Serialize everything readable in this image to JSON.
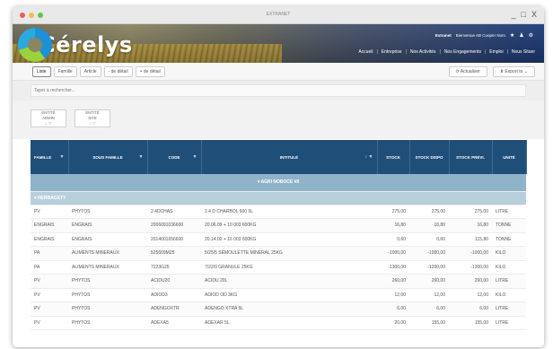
{
  "window": {
    "title": "EXTRANET",
    "controls": [
      "_",
      "□",
      "X"
    ]
  },
  "header": {
    "logo_text": "Cérelys",
    "user": {
      "label": "Extranet",
      "name": "Bienvenue AB Cooper Nom",
      "icons": [
        "star-icon",
        "user-icon",
        "gear-icon"
      ]
    },
    "nav": [
      "Accueil",
      "Entreprise",
      "Nos Activités",
      "Nos Engagements",
      "Emploi",
      "Nous Situer"
    ]
  },
  "toolbar": {
    "left_buttons": [
      "Liste",
      "Famille",
      "Article",
      "- de détail",
      "+ de détail"
    ],
    "active_index": 0,
    "refresh_label": "⟳ Actualiser",
    "export_label": "⬇ Export to  ⌄"
  },
  "search": {
    "placeholder": "Taper à rechercher..."
  },
  "filters": [
    {
      "line1": "ENTITÉ",
      "line2": "ADMIN",
      "icons": "↕ ▽"
    },
    {
      "line1": "ENTITÉ",
      "line2": "SITE",
      "icons": "↕ ▽"
    }
  ],
  "table": {
    "columns": [
      {
        "label": "FAMILLE",
        "filter": "▼"
      },
      {
        "label": "SOUS FAMILLE",
        "filter": "▼"
      },
      {
        "label": "CODE",
        "filter": "▼"
      },
      {
        "label": "INTITULÉ",
        "filter": "↕ ▼"
      },
      {
        "label": "STOCK",
        "filter": ""
      },
      {
        "label": "STOCK DISPO",
        "filter": ""
      },
      {
        "label": "STOCK PRÉVI.",
        "filter": ""
      },
      {
        "label": "UNITÉ",
        "filter": ""
      }
    ],
    "group_level1": "▾   AGRI NOBOCE #0",
    "group_level2": "▾  HERBAGETY",
    "rows": [
      [
        "PV",
        "PHYTOS",
        "2.4DCHAS",
        "2.4 D CHARBOL 600 5L",
        "275,00",
        "275,00",
        "275,00",
        "LITRE"
      ],
      [
        "ENGRAIS",
        "ENGRAIS",
        "2006091036600",
        "20.06.09 + 10 003 600KG",
        "16,80",
        "16,80",
        "16,80",
        "TONNE"
      ],
      [
        "ENGRAIS",
        "ENGRAIS",
        "2014001656600",
        "20.14.00 + 16 003 600KG",
        "0,60",
        "0,60",
        "115,80",
        "TONNE"
      ],
      [
        "PA",
        "ALIMENTS MINERAUX",
        "525609M25",
        "5/25/5 SEMOULETTE MINERAL 25KG",
        "-1000,00",
        "-1000,00",
        "-1000,00",
        "KILO"
      ],
      [
        "PA",
        "ALIMENTS MINERAUX",
        "7223G25",
        "7/22/9 GRANULE 25KG",
        "-1300,00",
        "-1200,00",
        "-1300,00",
        "KILO"
      ],
      [
        "PV",
        "PHYTOS",
        "ACIDU20",
        "ACIDU 20L",
        "260,00",
        "260,00",
        "260,00",
        "LITRE"
      ],
      [
        "PV",
        "PHYTOS",
        "ADIOD3",
        "ADIOD OD 3KG",
        "12,00",
        "12,00",
        "12,00",
        "KILO"
      ],
      [
        "PV",
        "PHYTOS",
        "ADENGOXTR",
        "ADENGO XTRA 5L",
        "6,00",
        "6,00",
        "6,00",
        "LITRE"
      ],
      [
        "PV",
        "PHYTOS",
        "ADEXA5",
        "ADEXAR 5L",
        "20,00",
        "155,00",
        "155,00",
        "LITRE"
      ]
    ]
  },
  "colors": {
    "header_blue": "#1f4e79",
    "group_row": "#8fb3c9",
    "subgroup_row": "#b7cfdb"
  }
}
